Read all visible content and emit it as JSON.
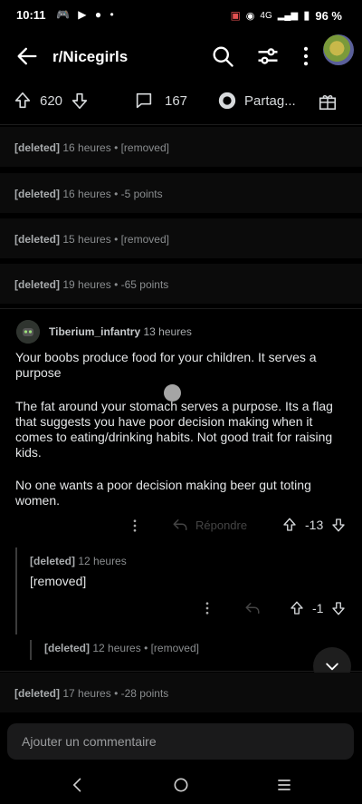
{
  "status_bar": {
    "time": "10:11",
    "network": "4G",
    "battery": "96 %"
  },
  "header": {
    "subreddit": "r/Nicegirls"
  },
  "post_actions": {
    "score": "620",
    "comments": "167",
    "share": "Partag..."
  },
  "deleted_rows": [
    {
      "user": "[deleted]",
      "meta": "16 heures • [removed]"
    },
    {
      "user": "[deleted]",
      "meta": "16 heures • -5 points"
    },
    {
      "user": "[deleted]",
      "meta": "15 heures • [removed]"
    },
    {
      "user": "[deleted]",
      "meta": "19 heures • -65 points"
    }
  ],
  "comment": {
    "author": "Tiberium_infantry",
    "time": "13 heures",
    "paragraphs": [
      "Your  boobs produce food for your  children. It serves a purpose",
      "The fat around your stomach serves a purpose. Its a flag that suggests you have poor decision making when it comes to eating/drinking habits. Not good trait for raising kids.",
      "No one wants a poor decision making beer gut toting women."
    ],
    "reply_label": "Répondre",
    "score": "-13"
  },
  "reply1": {
    "user": "[deleted]",
    "time": "12 heures",
    "body": "[removed]",
    "score": "-1"
  },
  "reply2": {
    "user": "[deleted]",
    "meta": "12 heures • [removed]"
  },
  "last_row": {
    "user": "[deleted]",
    "meta": "17 heures • -28 points"
  },
  "input": {
    "placeholder": "Ajouter un commentaire"
  }
}
